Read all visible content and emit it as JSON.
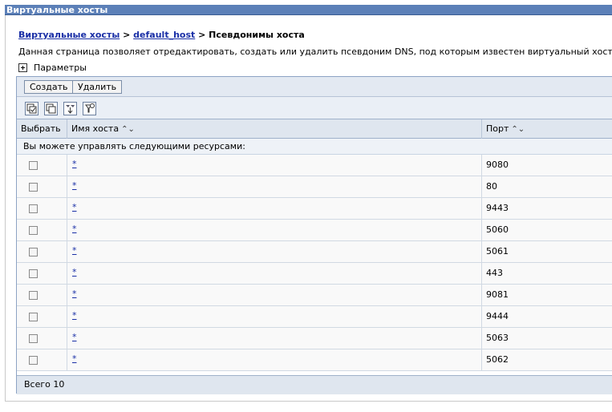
{
  "window": {
    "title": "Виртуальные хосты"
  },
  "breadcrumb": {
    "root": "Виртуальные хосты",
    "sep1": " > ",
    "host": "default_host",
    "sep2": " > ",
    "current": "Псевдонимы хоста"
  },
  "description": "Данная страница позволяет отредактировать, создать или удалить псевдоним DNS, под которым известен виртуальный хост.",
  "parameters": {
    "label": "Параметры"
  },
  "toolbar": {
    "create_label": "Создать",
    "delete_label": "Удалить"
  },
  "icon_toolbar": [
    "select-all-icon",
    "deselect-all-icon",
    "show-filter-icon",
    "clear-filter-icon"
  ],
  "table": {
    "columns": {
      "select": "Выбрать",
      "host": "Имя хоста",
      "port": "Порт"
    },
    "group_message": "Вы можете управлять следующими ресурсами:",
    "rows": [
      {
        "host": "*",
        "port": "9080"
      },
      {
        "host": "*",
        "port": "80"
      },
      {
        "host": "*",
        "port": "9443"
      },
      {
        "host": "*",
        "port": "5060"
      },
      {
        "host": "*",
        "port": "5061"
      },
      {
        "host": "*",
        "port": "443"
      },
      {
        "host": "*",
        "port": "9081"
      },
      {
        "host": "*",
        "port": "9444"
      },
      {
        "host": "*",
        "port": "5063"
      },
      {
        "host": "*",
        "port": "5062"
      }
    ],
    "total": "Всего 10"
  }
}
